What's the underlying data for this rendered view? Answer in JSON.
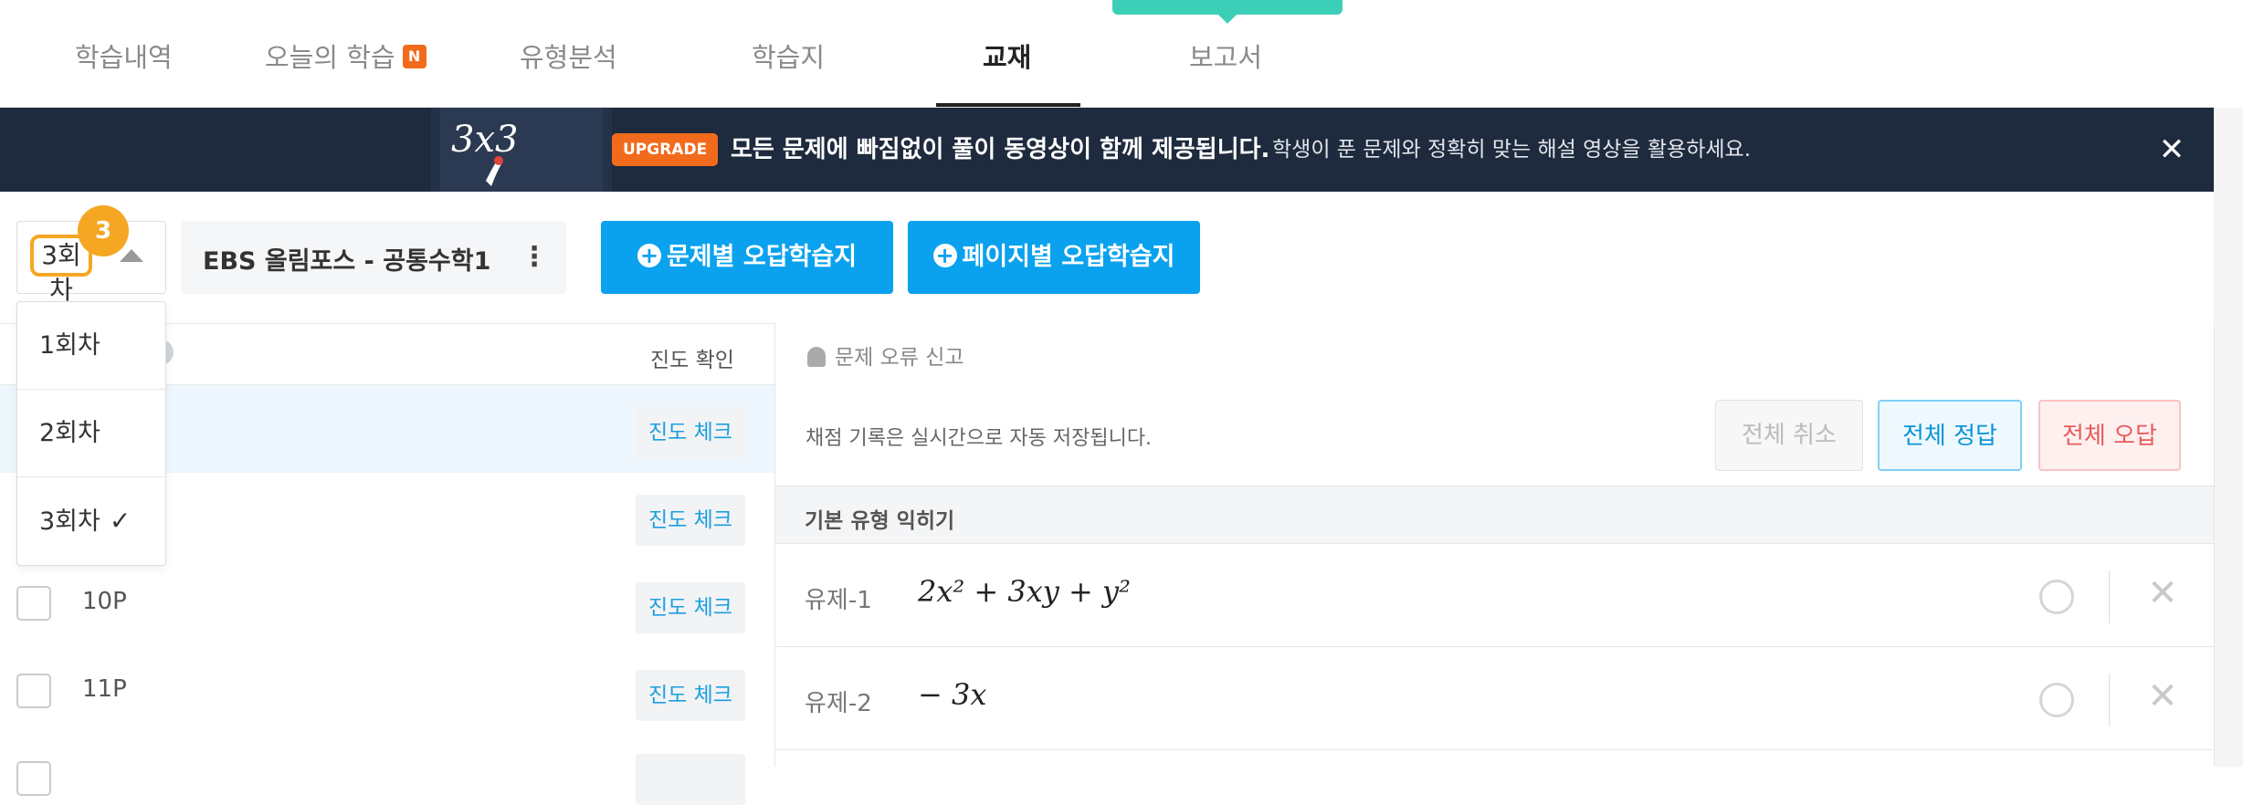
{
  "tabs": [
    {
      "label": "학습내역"
    },
    {
      "label": "오늘의 학습",
      "badge": "N"
    },
    {
      "label": "유형분석"
    },
    {
      "label": "학습지"
    },
    {
      "label": "교재",
      "active": true
    },
    {
      "label": "보고서"
    }
  ],
  "banner": {
    "art_text": "3x3",
    "upgrade_label": "UPGRADE",
    "headline": "모든 문제에 빠짐없이 풀이 동영상이 함께 제공됩니다.",
    "subtext": "학생이 푼 문제와 정확히 맞는 해설 영상을 활용하세요.",
    "close_label": "✕"
  },
  "round_select": {
    "value": "3회차",
    "step_badge": "3",
    "options": [
      "1회차",
      "2회차",
      "3회차"
    ],
    "selected_index": 2,
    "check_glyph": "✓"
  },
  "book": {
    "title": "EBS 올림포스 - 공통수학1",
    "more_glyph": "⋮"
  },
  "buttons": {
    "by_question": "문제별 오답학습지",
    "by_page": "페이지별 오답학습지",
    "plus_glyph": "+"
  },
  "left_panel": {
    "progress_header": "진도 확인",
    "rows": [
      {
        "page": "",
        "chip": "진도 체크",
        "highlighted": true
      },
      {
        "page": "",
        "chip": "진도 체크"
      },
      {
        "page": "10P",
        "chip": "진도 체크"
      },
      {
        "page": "11P",
        "chip": "진도 체크"
      }
    ]
  },
  "right_panel": {
    "report_label": "문제 오류 신고",
    "save_note": "채점 기록은 실시간으로 자동 저장됩니다.",
    "cancel_all": "전체 취소",
    "correct_all": "전체 정답",
    "wrong_all": "전체 오답",
    "section_title": "기본 유형 익히기",
    "questions": [
      {
        "label": "유제-1",
        "expr": "2x² + 3xy + y²"
      },
      {
        "label": "유제-2",
        "expr": "− 3x"
      }
    ],
    "correct_glyph": "○",
    "wrong_glyph": "✕"
  },
  "colors": {
    "accent_blue": "#0aa2ee",
    "badge_orange": "#f26b1d",
    "step_orange": "#f5a623",
    "banner_bg": "#1e2a3d",
    "teal": "#3ccfb7"
  }
}
